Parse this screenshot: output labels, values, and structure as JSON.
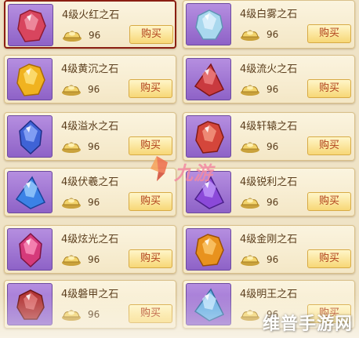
{
  "shop": {
    "items": [
      {
        "name": "4级火红之石",
        "price": "96",
        "buy_label": "购买",
        "gem": {
          "color": "#d8455e",
          "light": "#f6a4b5",
          "dark": "#8c1a30",
          "shape": "oval"
        }
      },
      {
        "name": "4级白雾之石",
        "price": "96",
        "buy_label": "购买",
        "gem": {
          "color": "#a9d8ee",
          "light": "#eaf7ff",
          "dark": "#5f93b4",
          "shape": "round"
        }
      },
      {
        "name": "4级黄沉之石",
        "price": "96",
        "buy_label": "购买",
        "gem": {
          "color": "#f0b320",
          "light": "#ffe98a",
          "dark": "#a86a06",
          "shape": "oval"
        }
      },
      {
        "name": "4级流火之石",
        "price": "96",
        "buy_label": "购买",
        "gem": {
          "color": "#c93a3f",
          "light": "#f38a8a",
          "dark": "#7d1518",
          "shape": "triangle"
        }
      },
      {
        "name": "4级溢水之石",
        "price": "96",
        "buy_label": "购买",
        "gem": {
          "color": "#3f63d6",
          "light": "#9db6ff",
          "dark": "#1e2f86",
          "shape": "pointed"
        }
      },
      {
        "name": "4级轩辕之石",
        "price": "96",
        "buy_label": "购买",
        "gem": {
          "color": "#d4463b",
          "light": "#f9a58d",
          "dark": "#7f1a15",
          "shape": "oval"
        }
      },
      {
        "name": "4级伏羲之石",
        "price": "96",
        "buy_label": "购买",
        "gem": {
          "color": "#3b82e6",
          "light": "#a8d6ff",
          "dark": "#1a449a",
          "shape": "triangle"
        }
      },
      {
        "name": "4级锐利之石",
        "price": "96",
        "buy_label": "购买",
        "gem": {
          "color": "#8b49d9",
          "light": "#c9a4ff",
          "dark": "#4b1f8a",
          "shape": "triangle"
        }
      },
      {
        "name": "4级炫光之石",
        "price": "96",
        "buy_label": "购买",
        "gem": {
          "color": "#d53a7a",
          "light": "#ff9ec6",
          "dark": "#7c1440",
          "shape": "pointed"
        }
      },
      {
        "name": "4级金刚之石",
        "price": "96",
        "buy_label": "购买",
        "gem": {
          "color": "#e8921e",
          "light": "#ffd27a",
          "dark": "#9a4f06",
          "shape": "oval"
        }
      },
      {
        "name": "4级磐甲之石",
        "price": "96",
        "buy_label": "购买",
        "gem": {
          "color": "#b23636",
          "light": "#e88080",
          "dark": "#6a1414",
          "shape": "round"
        }
      },
      {
        "name": "4级明王之石",
        "price": "96",
        "buy_label": "购买",
        "gem": {
          "color": "#6ab0e3",
          "light": "#d4efff",
          "dark": "#2f6a9c",
          "shape": "triangle"
        }
      }
    ]
  },
  "watermarks": {
    "logo_text": "九游",
    "site_text": "维普手游网"
  },
  "colors": {
    "card_bg": "#f4e7c6",
    "icon_bg": "#9b73d2",
    "buy_text": "#b0401b",
    "selected_border": "#8b1f12"
  },
  "icons": {
    "currency": "gold-ingot-icon",
    "logo": "nine-game-logo-icon"
  }
}
